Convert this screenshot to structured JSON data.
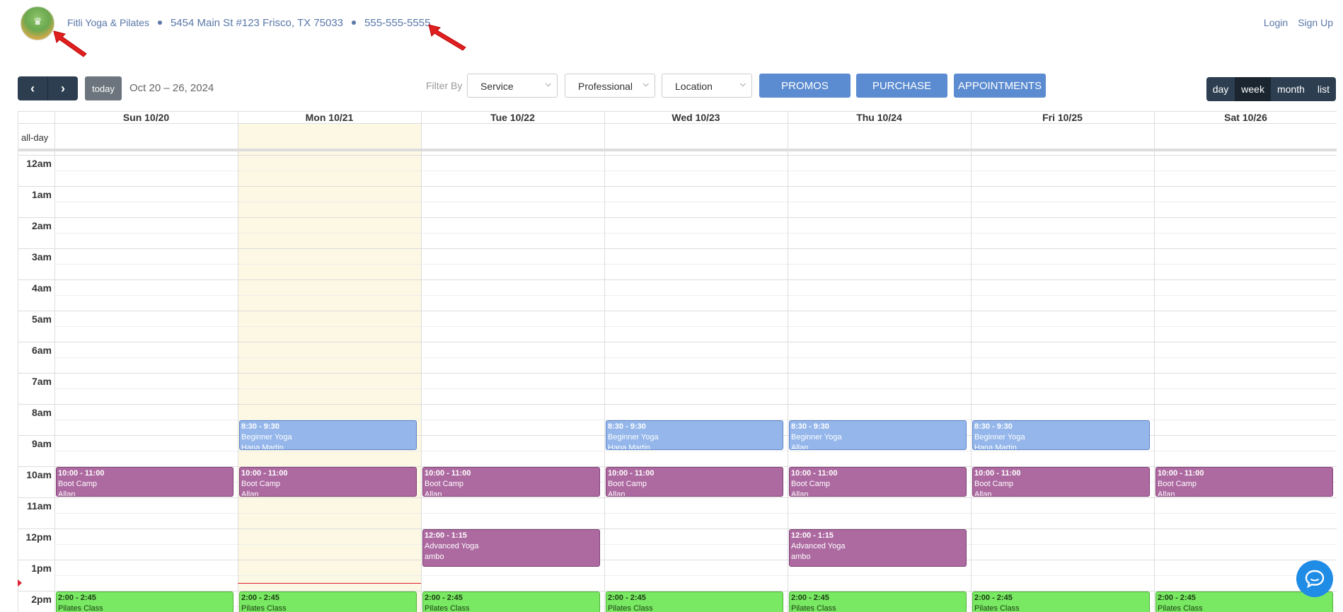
{
  "header": {
    "logo_icon": "lotus-logo",
    "business_name": "Fitli Yoga & Pilates",
    "address": "5454 Main St #123 Frisco, TX 75033",
    "phone": "555-555-5555",
    "login": "Login",
    "signup": "Sign Up"
  },
  "toolbar": {
    "prev_icon": "chevron-left-icon",
    "next_icon": "chevron-right-icon",
    "today": "today",
    "date_range": "Oct 20 – 26, 2024",
    "filter_label": "Filter By",
    "service": "Service",
    "professional": "Professional",
    "location": "Location",
    "promos": "PROMOS",
    "purchase": "PURCHASE",
    "appointments": "APPOINTMENTS",
    "views": [
      "day",
      "week",
      "month",
      "list"
    ],
    "active_view": "week"
  },
  "calendar": {
    "days": [
      "Sun 10/20",
      "Mon 10/21",
      "Tue 10/22",
      "Wed 10/23",
      "Thu 10/24",
      "Fri 10/25",
      "Sat 10/26"
    ],
    "today_index": 1,
    "allday_label": "all-day",
    "hours": [
      "12am",
      "1am",
      "2am",
      "3am",
      "4am",
      "5am",
      "6am",
      "7am",
      "8am",
      "9am",
      "10am",
      "11am",
      "12pm",
      "1pm",
      "2pm"
    ],
    "events": [
      {
        "day": 1,
        "start": 8.5,
        "end": 9.5,
        "time": "8:30 - 9:30",
        "title": "Beginner Yoga",
        "who": "Hana Martin",
        "color": "blue"
      },
      {
        "day": 3,
        "start": 8.5,
        "end": 9.5,
        "time": "8:30 - 9:30",
        "title": "Beginner Yoga",
        "who": "Hana Martin",
        "color": "blue"
      },
      {
        "day": 4,
        "start": 8.5,
        "end": 9.5,
        "time": "8:30 - 9:30",
        "title": "Beginner Yoga",
        "who": "Allan",
        "color": "blue"
      },
      {
        "day": 5,
        "start": 8.5,
        "end": 9.5,
        "time": "8:30 - 9:30",
        "title": "Beginner Yoga",
        "who": "Hana Martin",
        "color": "blue"
      },
      {
        "day": 0,
        "start": 10,
        "end": 11,
        "time": "10:00 - 11:00",
        "title": "Boot Camp",
        "who": "Allan",
        "color": "purple"
      },
      {
        "day": 1,
        "start": 10,
        "end": 11,
        "time": "10:00 - 11:00",
        "title": "Boot Camp",
        "who": "Allan",
        "color": "purple"
      },
      {
        "day": 2,
        "start": 10,
        "end": 11,
        "time": "10:00 - 11:00",
        "title": "Boot Camp",
        "who": "Allan",
        "color": "purple"
      },
      {
        "day": 3,
        "start": 10,
        "end": 11,
        "time": "10:00 - 11:00",
        "title": "Boot Camp",
        "who": "Allan",
        "color": "purple"
      },
      {
        "day": 4,
        "start": 10,
        "end": 11,
        "time": "10:00 - 11:00",
        "title": "Boot Camp",
        "who": "Allan",
        "color": "purple"
      },
      {
        "day": 5,
        "start": 10,
        "end": 11,
        "time": "10:00 - 11:00",
        "title": "Boot Camp",
        "who": "Allan",
        "color": "purple"
      },
      {
        "day": 6,
        "start": 10,
        "end": 11,
        "time": "10:00 - 11:00",
        "title": "Boot Camp",
        "who": "Allan",
        "color": "purple"
      },
      {
        "day": 2,
        "start": 12,
        "end": 13.25,
        "time": "12:00 - 1:15",
        "title": "Advanced Yoga",
        "who": "ambo",
        "color": "purple"
      },
      {
        "day": 4,
        "start": 12,
        "end": 13.25,
        "time": "12:00 - 1:15",
        "title": "Advanced Yoga",
        "who": "ambo",
        "color": "purple"
      },
      {
        "day": 0,
        "start": 14,
        "end": 14.75,
        "time": "2:00 - 2:45",
        "title": "Pilates Class",
        "who": "",
        "color": "green"
      },
      {
        "day": 1,
        "start": 14,
        "end": 14.75,
        "time": "2:00 - 2:45",
        "title": "Pilates Class",
        "who": "",
        "color": "green"
      },
      {
        "day": 2,
        "start": 14,
        "end": 14.75,
        "time": "2:00 - 2:45",
        "title": "Pilates Class",
        "who": "",
        "color": "green"
      },
      {
        "day": 3,
        "start": 14,
        "end": 14.75,
        "time": "2:00 - 2:45",
        "title": "Pilates Class",
        "who": "",
        "color": "green"
      },
      {
        "day": 4,
        "start": 14,
        "end": 14.75,
        "time": "2:00 - 2:45",
        "title": "Pilates Class",
        "who": "",
        "color": "green"
      },
      {
        "day": 5,
        "start": 14,
        "end": 14.75,
        "time": "2:00 - 2:45",
        "title": "Pilates Class",
        "who": "",
        "color": "green"
      },
      {
        "day": 6,
        "start": 14,
        "end": 14.75,
        "time": "2:00 - 2:45",
        "title": "Pilates Class",
        "who": "",
        "color": "green"
      }
    ],
    "now_hour": 13.75
  },
  "chat_icon": "chat-bubble-icon",
  "colors": {
    "navy": "#2c3e50",
    "accent": "#5b8bd0",
    "today_bg": "#fcf8e3"
  }
}
